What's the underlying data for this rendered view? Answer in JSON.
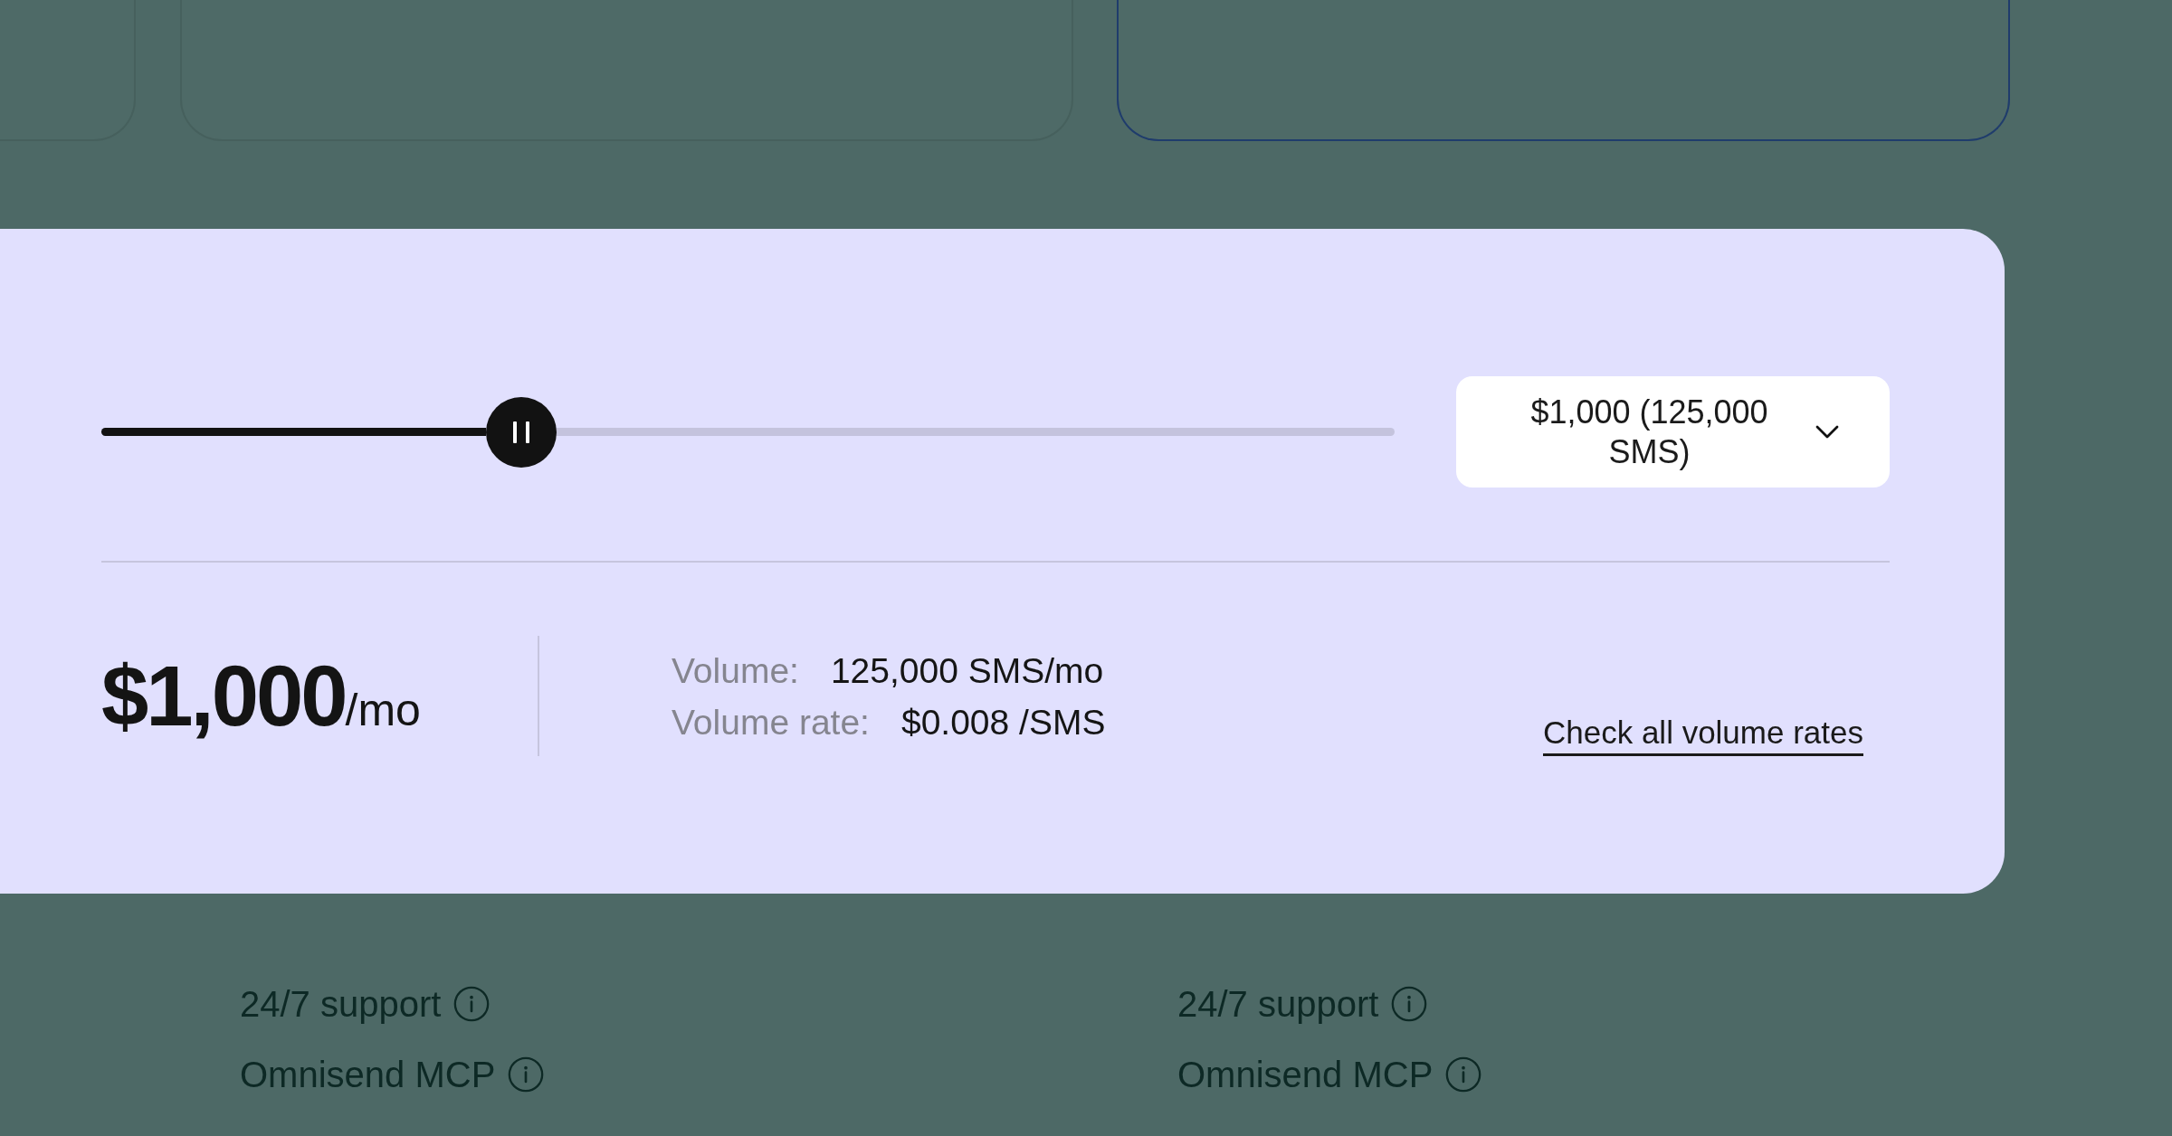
{
  "plan_cards": [
    {
      "selected": false
    },
    {
      "selected": false
    },
    {
      "selected": true
    }
  ],
  "sms_pricing": {
    "slider": {
      "level": 0.325
    },
    "dropdown": {
      "value": "$1,000 (125,000 SMS)"
    },
    "price": {
      "amount": "$1,000",
      "period": "/mo"
    },
    "details": [
      {
        "label": "Volume:",
        "value": "125,000 SMS/mo"
      },
      {
        "label": "Volume rate:",
        "value": "$0.008 /SMS"
      }
    ],
    "link": "Check all volume rates"
  },
  "feature_columns": [
    {
      "features": [
        "24/7 support",
        "Omnisend MCP"
      ]
    },
    {
      "features": [
        "24/7 support",
        "Omnisend MCP"
      ]
    }
  ]
}
